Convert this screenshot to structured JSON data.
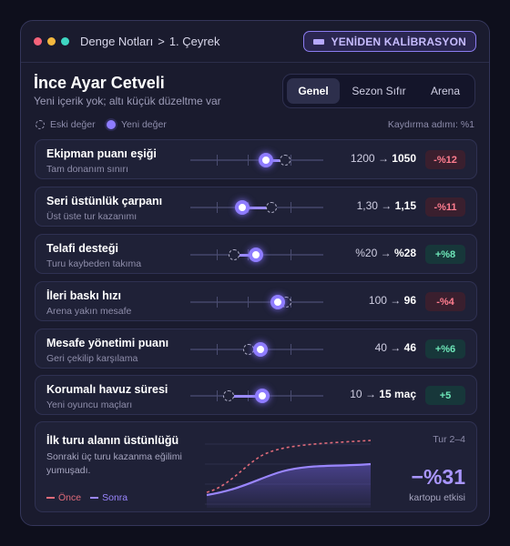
{
  "window": {
    "dots": [
      "#f5637a",
      "#f4b83e",
      "#3ed6c2"
    ],
    "breadcrumb": [
      "Denge Notları",
      ">",
      "1. Çeyrek"
    ],
    "recalibrate_label": "YENİDEN KALİBRASYON"
  },
  "header": {
    "title": "İnce Ayar Cetveli",
    "subtitle": "Yeni içerik yok; altı küçük düzeltme var"
  },
  "tabs": [
    {
      "label": "Genel",
      "active": true
    },
    {
      "label": "Sezon Sıfır",
      "active": false
    },
    {
      "label": "Arena",
      "active": false
    }
  ],
  "legend": {
    "old_label": "Eski değer",
    "new_label": "Yeni değer",
    "step_note": "Kaydırma adımı: %1"
  },
  "rows": [
    {
      "name": "Ekipman puanı eşiği",
      "desc": "Tam donanım sınırı",
      "old": "1200",
      "arrow": "→",
      "new": "1050",
      "delta": "-%12",
      "sign": "neg",
      "old_pos": 0.71,
      "new_pos": 0.57
    },
    {
      "name": "Seri üstünlük çarpanı",
      "desc": "Üst üste tur kazanımı",
      "old": "1,30",
      "arrow": "→",
      "new": "1,15",
      "delta": "-%11",
      "sign": "neg",
      "old_pos": 0.61,
      "new_pos": 0.39
    },
    {
      "name": "Telafi desteği",
      "desc": "Turu kaybeden takıma",
      "old": "%20",
      "arrow": "→",
      "new": "%28",
      "delta": "+%8",
      "sign": "pos",
      "old_pos": 0.33,
      "new_pos": 0.49
    },
    {
      "name": "İleri baskı hızı",
      "desc": "Arena yakın mesafe",
      "old": "100",
      "arrow": "→",
      "new": "96",
      "delta": "-%4",
      "sign": "neg",
      "old_pos": 0.72,
      "new_pos": 0.66
    },
    {
      "name": "Mesafe yönetimi puanı",
      "desc": "Geri çekilip karşılama",
      "old": "40",
      "arrow": "→",
      "new": "46",
      "delta": "+%6",
      "sign": "pos",
      "old_pos": 0.44,
      "new_pos": 0.53
    },
    {
      "name": "Korumalı havuz süresi",
      "desc": "Yeni oyuncu maçları",
      "old": "10",
      "arrow": "→",
      "new": "15 maç",
      "delta": "+5",
      "sign": "pos",
      "old_pos": 0.29,
      "new_pos": 0.54
    }
  ],
  "summary": {
    "title": "İlk turu alanın üstünlüğü",
    "text": "Sonraki üç turu kazanma eğilimi yumuşadı.",
    "legend_before": "Önce",
    "legend_after": "Sonra",
    "range": "Tur 2–4",
    "value": "−%31",
    "caption": "kartopu etkisi",
    "colors": {
      "before": "#e06b7a",
      "after": "#9a86ff"
    }
  }
}
